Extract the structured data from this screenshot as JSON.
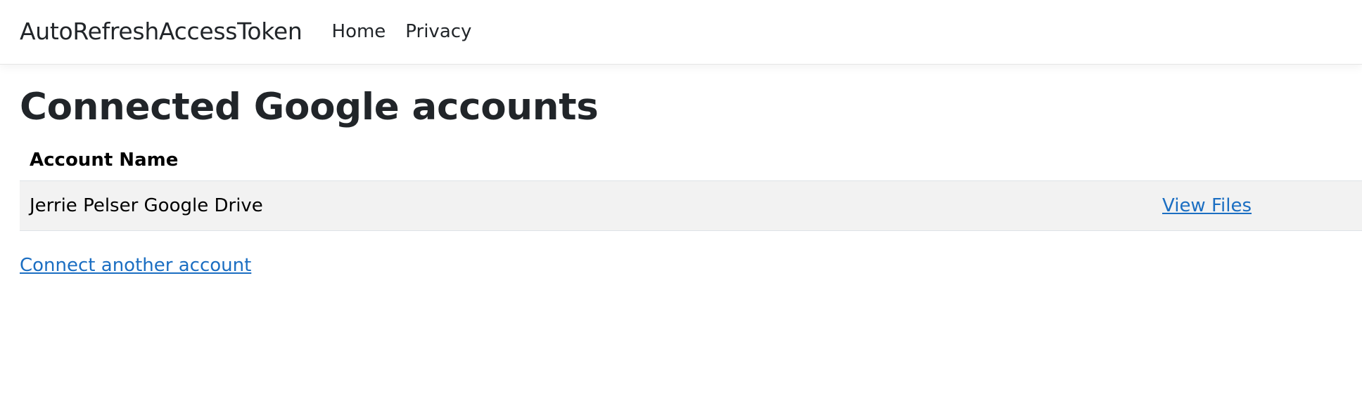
{
  "navbar": {
    "brand": "AutoRefreshAccessToken",
    "links": [
      {
        "label": "Home"
      },
      {
        "label": "Privacy"
      }
    ]
  },
  "main": {
    "title": "Connected Google accounts",
    "table": {
      "columns": [
        "Account Name",
        ""
      ],
      "rows": [
        {
          "name": "Jerrie Pelser Google Drive",
          "action": "View Files"
        }
      ]
    },
    "connect_label": "Connect another account"
  },
  "colors": {
    "link": "#1b6ec2",
    "row_background": "#f2f2f2",
    "text": "#212529"
  }
}
